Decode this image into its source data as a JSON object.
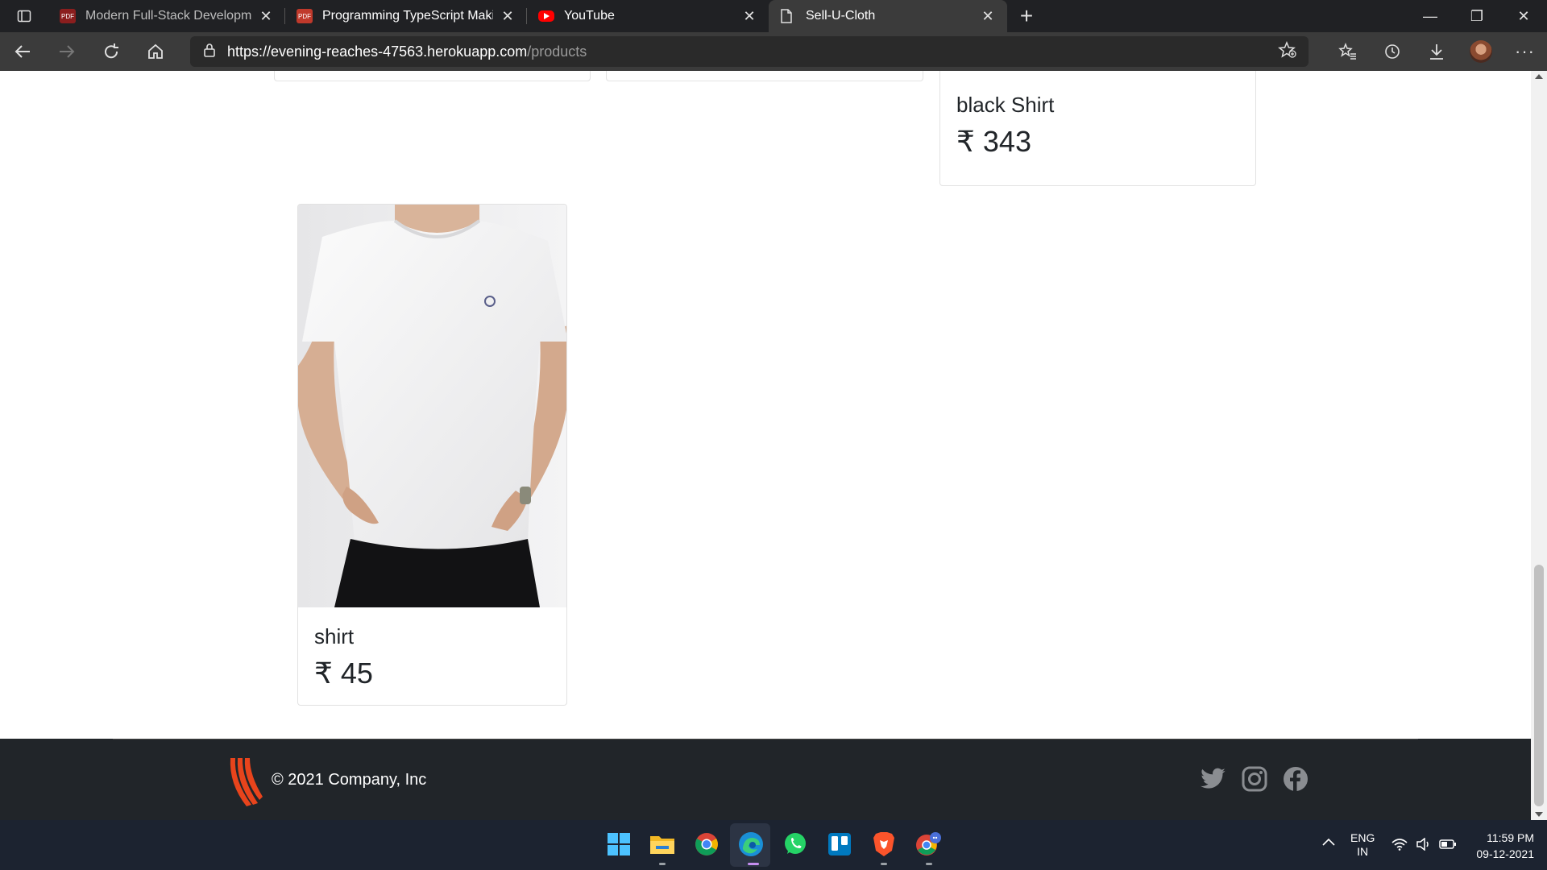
{
  "browser": {
    "tabs": [
      {
        "title": "Modern Full-Stack Development",
        "icon": "pdf-icon",
        "active": false
      },
      {
        "title": "Programming TypeScript Making",
        "icon": "pdf-icon",
        "active": false
      },
      {
        "title": "YouTube",
        "icon": "youtube-icon",
        "active": false
      },
      {
        "title": "Sell-U-Cloth",
        "icon": "page-icon",
        "active": true
      }
    ],
    "url_host": "https://evening-reaches-47563.herokuapp.com",
    "url_path": "/products"
  },
  "products": [
    {
      "name": "black Shirt",
      "price": "₹ 343"
    },
    {
      "name": "shirt",
      "price": "₹ 45"
    }
  ],
  "footer": {
    "copyright": "© 2021 Company, Inc",
    "social": [
      "twitter-icon",
      "instagram-icon",
      "facebook-icon"
    ]
  },
  "taskbar": {
    "lang_line1": "ENG",
    "lang_line2": "IN",
    "time": "11:59 PM",
    "date": "09-12-2021"
  },
  "colors": {
    "footer_bg": "#212529",
    "browser_dark": "#202124",
    "youtube_red": "#ff0000",
    "brand_orange": "#e8441c"
  }
}
